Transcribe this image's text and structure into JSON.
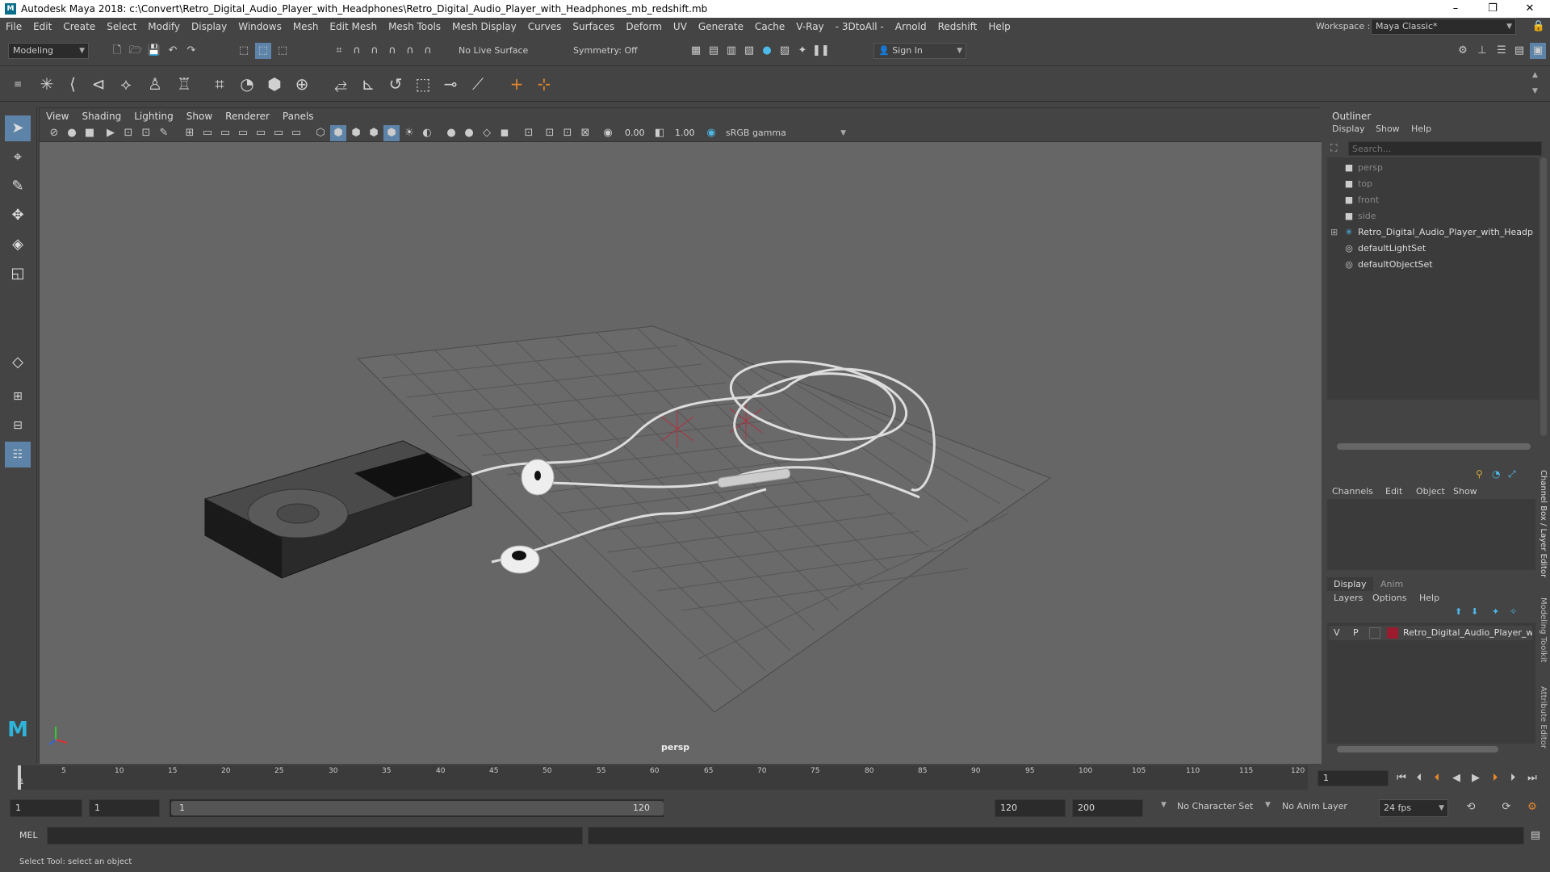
{
  "titlebar": {
    "title": "Autodesk Maya 2018: c:\\Convert\\Retro_Digital_Audio_Player_with_Headphones\\Retro_Digital_Audio_Player_with_Headphones_mb_redshift.mb",
    "app_letter": "M",
    "min": "–",
    "max": "❐",
    "close": "✕"
  },
  "menubar": {
    "items": [
      "File",
      "Edit",
      "Create",
      "Select",
      "Modify",
      "Display",
      "Windows",
      "Mesh",
      "Edit Mesh",
      "Mesh Tools",
      "Mesh Display",
      "Curves",
      "Surfaces",
      "Deform",
      "UV",
      "Generate",
      "Cache",
      "V-Ray",
      "- 3DtoAll -",
      "Arnold",
      "Redshift",
      "Help"
    ],
    "workspace_label": "Workspace :",
    "workspace_value": "Maya Classic*"
  },
  "statusline": {
    "mode": "Modeling",
    "live_surface": "No Live Surface",
    "symmetry": "Symmetry: Off",
    "sign_in": "Sign In"
  },
  "viewport": {
    "menu": [
      "View",
      "Shading",
      "Lighting",
      "Show",
      "Renderer",
      "Panels"
    ],
    "exposure": "0.00",
    "gamma": "1.00",
    "color_space": "sRGB gamma",
    "camera_label": "persp"
  },
  "outliner": {
    "title": "Outliner",
    "menu": [
      "Display",
      "Show",
      "Help"
    ],
    "search_placeholder": "Search...",
    "items": [
      {
        "label": "persp",
        "dim": true
      },
      {
        "label": "top",
        "dim": true
      },
      {
        "label": "front",
        "dim": true
      },
      {
        "label": "side",
        "dim": true
      },
      {
        "label": "Retro_Digital_Audio_Player_with_Headp",
        "dim": false
      },
      {
        "label": "defaultLightSet",
        "dim": false
      },
      {
        "label": "defaultObjectSet",
        "dim": false
      }
    ],
    "expand": "⊞"
  },
  "channelbox": {
    "menu": [
      "Channels",
      "Edit",
      "Object",
      "Show"
    ]
  },
  "layers": {
    "tabs": [
      "Display",
      "Anim"
    ],
    "menu": [
      "Layers",
      "Options",
      "Help"
    ],
    "layer": {
      "v": "V",
      "p": "P",
      "name": "Retro_Digital_Audio_Player_wi",
      "color": "#9b1a2e"
    }
  },
  "side_tabs": [
    "Channel Box / Layer Editor",
    "Modeling Toolkit",
    "Attribute Editor"
  ],
  "timeline": {
    "ticks": [
      "1",
      "5",
      "10",
      "15",
      "20",
      "25",
      "30",
      "35",
      "40",
      "45",
      "50",
      "55",
      "60",
      "65",
      "70",
      "75",
      "80",
      "85",
      "90",
      "95",
      "100",
      "105",
      "110",
      "115",
      "120"
    ],
    "current_frame": "1"
  },
  "range": {
    "start": "1",
    "playback_start": "1",
    "slider_start": "1",
    "slider_end": "120",
    "playback_end": "120",
    "end": "200",
    "character_set": "No Character Set",
    "anim_layer": "No Anim Layer",
    "fps": "24 fps"
  },
  "cmdline": {
    "label": "MEL"
  },
  "helpline": {
    "text": "Select Tool: select an object"
  }
}
